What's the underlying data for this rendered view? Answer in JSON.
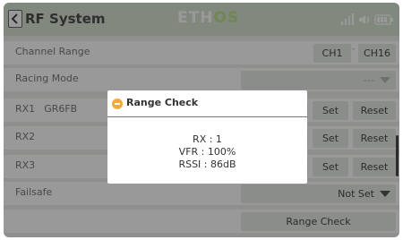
{
  "header": {
    "title": "RF System",
    "logo_main": "ETH",
    "logo_accent": "OS",
    "status_icons": [
      "signal-icon",
      "volume-icon",
      "battery-icon"
    ]
  },
  "rows": {
    "channel_range": {
      "label": "Channel Range",
      "start": "CH1",
      "separator": "-",
      "end": "CH16"
    },
    "racing_mode": {
      "label": "Racing Mode",
      "value": "---"
    },
    "rx1": {
      "label": "RX1",
      "device": "GR6FB",
      "set": "Set",
      "reset": "Reset"
    },
    "rx2": {
      "label": "RX2",
      "set": "Set",
      "reset": "Reset"
    },
    "rx3": {
      "label": "RX3",
      "set": "Set",
      "reset": "Reset"
    },
    "failsafe": {
      "label": "Failsafe",
      "value": "Not Set"
    },
    "range_check_button": "Range Check"
  },
  "dialog": {
    "title": "Range Check",
    "rx": "RX : 1",
    "vfr": "VFR : 100%",
    "rssi": "RSSI : 86dB"
  },
  "colors": {
    "header_bg": "#d7e3d3",
    "logo_accent": "#bfe08c",
    "dialog_icon": "#f3a93c"
  }
}
